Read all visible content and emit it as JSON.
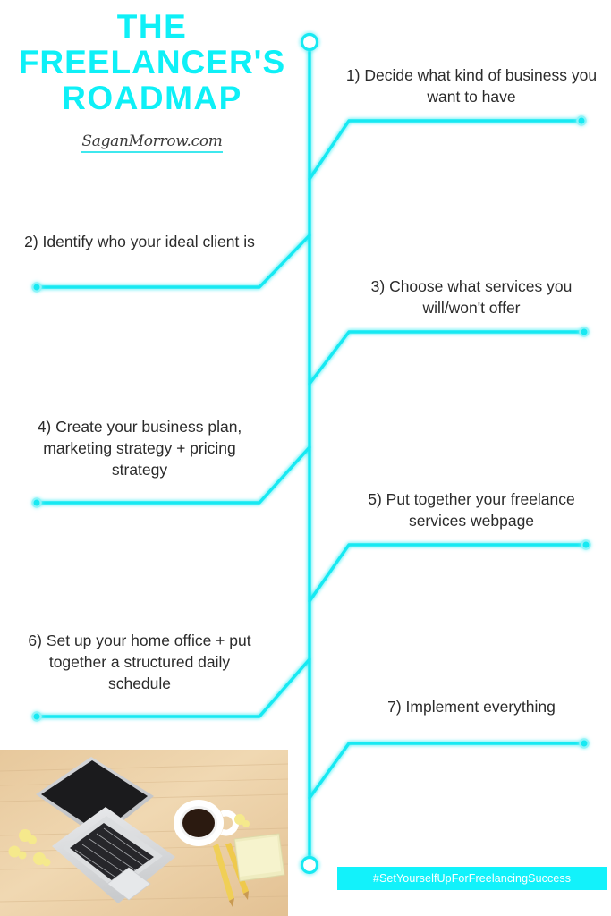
{
  "header": {
    "title_line1": "THE",
    "title_line2": "FREELANCER'S",
    "title_line3": "ROADMAP",
    "signature": "SaganMorrow.com"
  },
  "colors": {
    "accent_cyan": "#0ef0f7",
    "line_cyan": "#19e9f2",
    "text_dark": "#2b2b2b",
    "banner_cyan": "#12f2fb",
    "banner_text": "#ffffff"
  },
  "steps": [
    {
      "number": "1)",
      "text": "1) Decide what kind of business you want to have",
      "side": "right"
    },
    {
      "number": "2)",
      "text": "2) Identify who your ideal client is",
      "side": "left"
    },
    {
      "number": "3)",
      "text": "3) Choose what services you will/won't offer",
      "side": "right"
    },
    {
      "number": "4)",
      "text": "4) Create your business plan, marketing strategy + pricing strategy",
      "side": "left"
    },
    {
      "number": "5)",
      "text": "5) Put together your freelance services webpage",
      "side": "right"
    },
    {
      "number": "6)",
      "text": "6) Set up your home office + put together a structured daily schedule",
      "side": "left"
    },
    {
      "number": "7)",
      "text": "7) Implement everything",
      "side": "right"
    }
  ],
  "footer": {
    "hashtag": "#SetYourselfUpForFreelancingSuccess"
  },
  "photo": {
    "description": "flat-lay desk photo with laptop, coffee cup, pencils and sticky notes on a wooden table"
  }
}
